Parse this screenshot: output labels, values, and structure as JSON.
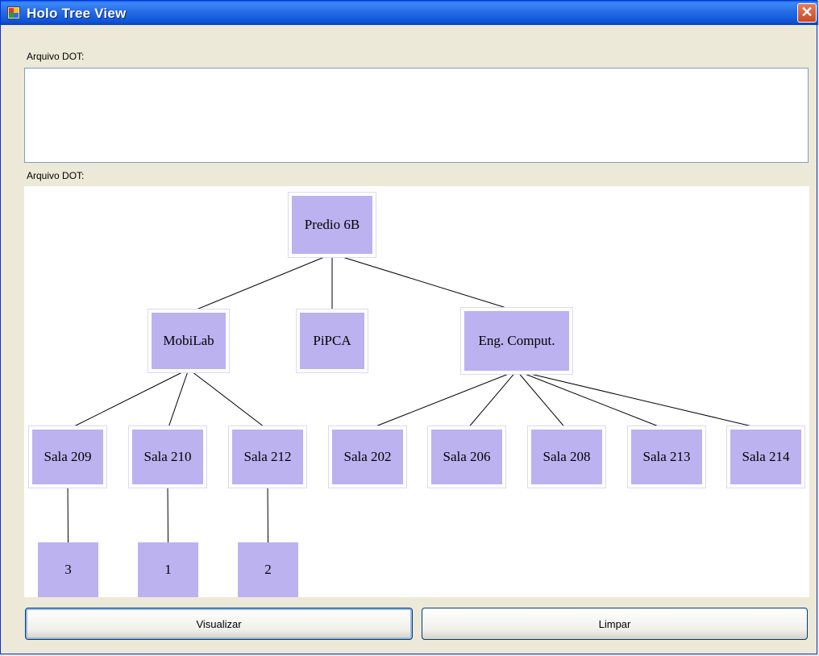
{
  "window": {
    "title": "Holo Tree View",
    "close_glyph": "✕",
    "icon": "app-window-icon"
  },
  "labels": {
    "dot_input": "Arquivo DOT:",
    "dot_canvas": "Arquivo DOT:"
  },
  "dot_input": {
    "value": ""
  },
  "tree": {
    "node_fill": "#bcb2f0",
    "nodes": {
      "root": "Predio 6B",
      "mobilab": "MobiLab",
      "pipca": "PiPCA",
      "engcomp": "Eng. Comput.",
      "s209": "Sala 209",
      "s210": "Sala 210",
      "s212": "Sala 212",
      "s202": "Sala 202",
      "s206": "Sala 206",
      "s208": "Sala 208",
      "s213": "Sala 213",
      "s214": "Sala 214",
      "n3": "3",
      "n1": "1",
      "n2": "2"
    },
    "edges": [
      [
        "root",
        "mobilab"
      ],
      [
        "root",
        "pipca"
      ],
      [
        "root",
        "engcomp"
      ],
      [
        "mobilab",
        "s209"
      ],
      [
        "mobilab",
        "s210"
      ],
      [
        "mobilab",
        "s212"
      ],
      [
        "engcomp",
        "s202"
      ],
      [
        "engcomp",
        "s206"
      ],
      [
        "engcomp",
        "s208"
      ],
      [
        "engcomp",
        "s213"
      ],
      [
        "engcomp",
        "s214"
      ],
      [
        "s209",
        "n3"
      ],
      [
        "s210",
        "n1"
      ],
      [
        "s212",
        "n2"
      ]
    ]
  },
  "buttons": {
    "visualize": "Visualizar",
    "clear": "Limpar"
  }
}
